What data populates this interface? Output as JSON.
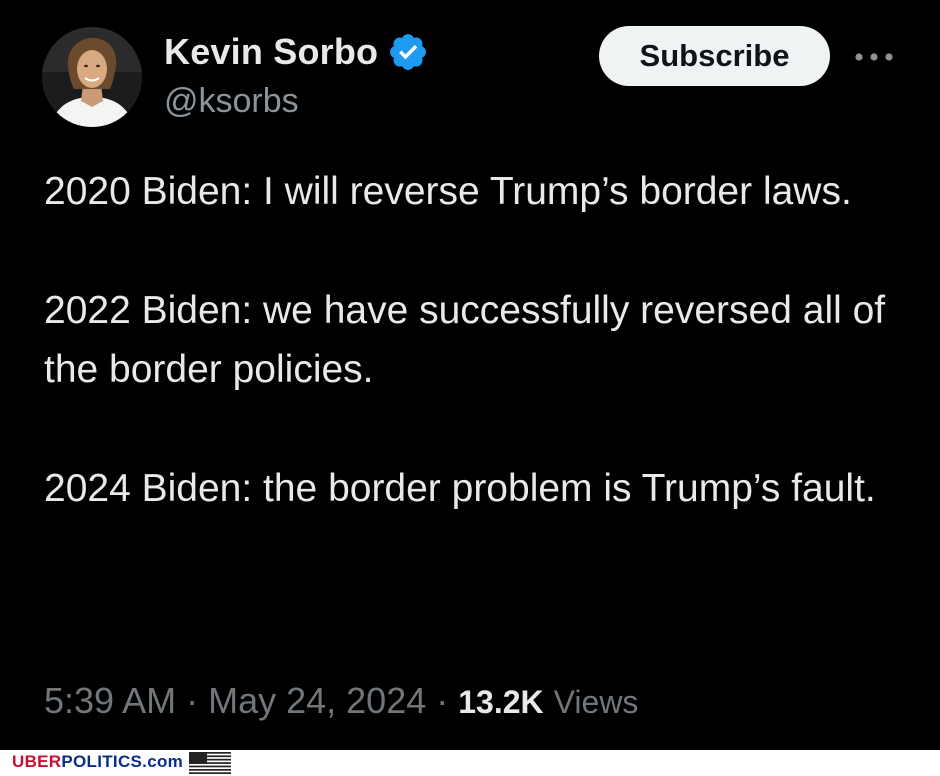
{
  "author": {
    "display_name": "Kevin Sorbo",
    "handle": "@ksorbs",
    "verified_icon": "verified-badge-icon",
    "avatar_icon": "profile-avatar"
  },
  "actions": {
    "subscribe_label": "Subscribe",
    "more_icon": "more-options-icon"
  },
  "tweet": {
    "paragraphs": [
      "2020 Biden: I will reverse Trump’s border laws.",
      "2022 Biden: we have successfully reversed all of the border policies.",
      "2024 Biden: the border problem is Trump’s fault."
    ]
  },
  "meta": {
    "time": "5:39 AM",
    "separator": "·",
    "date": "May 24, 2024",
    "views_count": "13.2K",
    "views_label": "Views"
  },
  "watermark": {
    "part1": "UBER",
    "part2": "POLITICS",
    "part3": ".com",
    "flag_icon": "us-flag-icon"
  },
  "colors": {
    "background": "#000000",
    "text_primary": "#e7e9ea",
    "text_secondary": "#71767b",
    "verified_blue": "#1d9bf0",
    "button_bg": "#eff3f4"
  }
}
